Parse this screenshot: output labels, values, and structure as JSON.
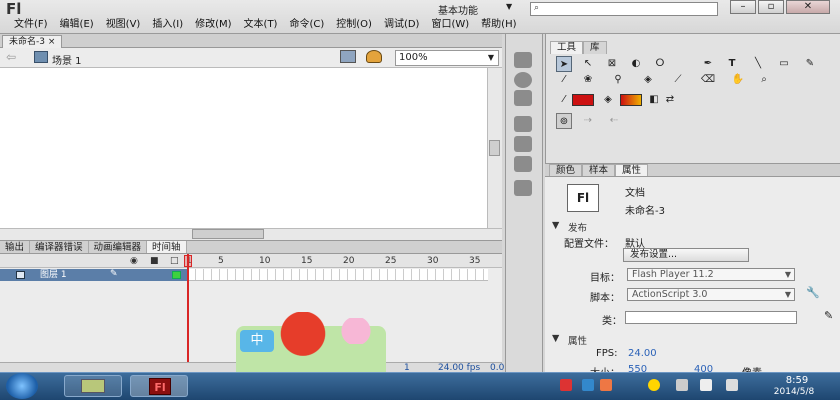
{
  "app": {
    "logo": "Fl",
    "workspace": "基本功能",
    "search_placeholder": ""
  },
  "menu": [
    "文件(F)",
    "编辑(E)",
    "视图(V)",
    "插入(I)",
    "修改(M)",
    "文本(T)",
    "命令(C)",
    "控制(O)",
    "调试(D)",
    "窗口(W)",
    "帮助(H)"
  ],
  "document_tab": "未命名-3 ×",
  "edit_bar": {
    "scene": "场景 1",
    "zoom": "100%"
  },
  "bottom_tabs": [
    "输出",
    "编译器错误",
    "动画编辑器",
    "时间轴"
  ],
  "timeline": {
    "frame_numbers": [
      "1",
      "5",
      "10",
      "15",
      "20",
      "25",
      "30",
      "35"
    ],
    "layer_name": "图层 1",
    "footer_frame": "1",
    "footer_fps": "24.00 fps",
    "footer_time": "0.0"
  },
  "tools_tabs": [
    "工具",
    "库"
  ],
  "props_tabs": [
    "颜色",
    "样本",
    "属性"
  ],
  "properties": {
    "doc_icon": "Fl",
    "doc_type": "文档",
    "doc_name": "未命名-3",
    "publish_section": "发布",
    "profile_label": "配置文件：",
    "profile_value": "默认",
    "publish_settings_button": "发布设置...",
    "target_label": "目标：",
    "target_value": "Flash Player 11.2",
    "script_label": "脚本：",
    "script_value": "ActionScript 3.0",
    "class_label": "类：",
    "class_value": "",
    "props_section": "属性",
    "fps_label": "FPS:",
    "fps_value": "24.00",
    "size_label": "大小：",
    "size_w": "550",
    "size_h": "400",
    "size_units": "像素"
  },
  "ime": {
    "char": "中"
  },
  "taskbar": {
    "time": "8:59",
    "date": "2014/5/8"
  },
  "colors": {
    "stroke": "#cc1111",
    "layer_highlight": "#5b7ea8",
    "playhead": "#d92626"
  }
}
